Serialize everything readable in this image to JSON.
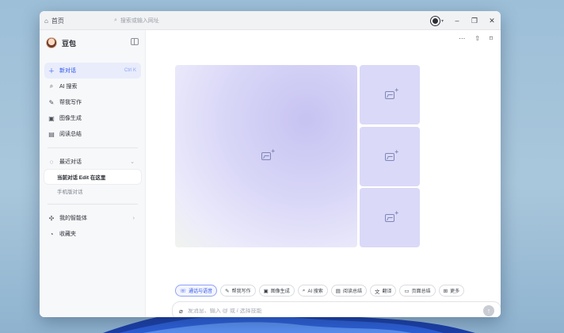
{
  "titlebar": {
    "home_label": "首页",
    "address_placeholder": "搜索或输入网址",
    "window_controls": [
      "minimize",
      "maximize",
      "close"
    ]
  },
  "sidebar": {
    "brand_name": "豆包",
    "new_chat": {
      "label": "新对话",
      "shortcut": "Ctrl K"
    },
    "items": [
      {
        "label": "AI 搜索",
        "icon": "search-icon"
      },
      {
        "label": "帮我写作",
        "icon": "pen-icon"
      },
      {
        "label": "图像生成",
        "icon": "image-icon"
      },
      {
        "label": "阅读总结",
        "icon": "book-icon"
      }
    ],
    "recent": {
      "label": "最近对话",
      "conversations": [
        {
          "label": "当前对话 Edit 在这里",
          "selected": true
        },
        {
          "label": "手机版对话",
          "selected": false
        }
      ]
    },
    "bots_label": "我的智能体",
    "favorites_label": "收藏夹"
  },
  "main": {
    "gallery_tiles": 4,
    "chips": [
      {
        "label": "通话与语音",
        "icon": "phone-icon",
        "primary": true
      },
      {
        "label": "帮我写作",
        "icon": "pen-icon"
      },
      {
        "label": "图像生成",
        "icon": "image-icon"
      },
      {
        "label": "AI 搜索",
        "icon": "search-icon"
      },
      {
        "label": "阅读总结",
        "icon": "book-icon"
      },
      {
        "label": "翻译",
        "icon": "translate-icon"
      },
      {
        "label": "页面总结",
        "icon": "page-icon"
      },
      {
        "label": "更多",
        "icon": "grid-icon"
      }
    ],
    "input_placeholder": "发消息、输入 @ 或 / 选择技能"
  },
  "colors": {
    "accent": "#2f54eb",
    "tile": "#dad9f8",
    "desktop": "#a9c7dc"
  }
}
